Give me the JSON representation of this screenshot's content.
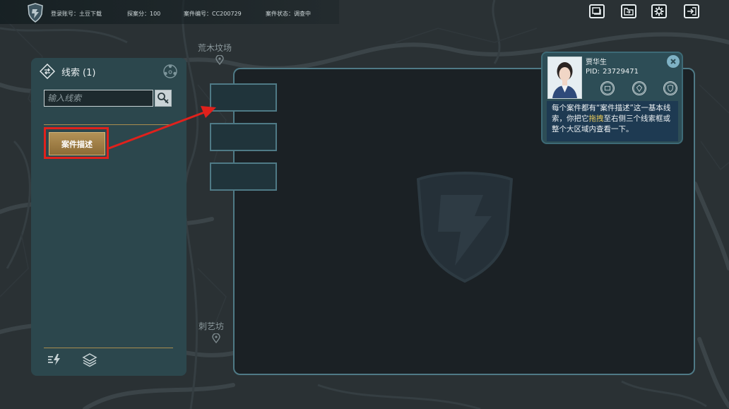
{
  "top_bar": {
    "account": "登录账号：土豆下载",
    "score": "探案分：100",
    "case_no": "案件编号：CC200729",
    "case_status": "案件状态：调查中",
    "buttons": [
      "screen-icon",
      "folder-icon",
      "gear-icon",
      "exit-icon"
    ]
  },
  "map": {
    "place_labels": [
      "荒木坟场",
      "刺艺坊"
    ]
  },
  "clue_panel": {
    "title": "线索",
    "count": "(1)",
    "search_placeholder": "输入线索",
    "clues": [
      "案件描述"
    ]
  },
  "npc": {
    "name": "贾华生",
    "pid_label": "PID:",
    "pid": "23729471",
    "dialog_before": "每个案件都有“案件描述”这一基本线索，你把它",
    "dialog_highlight": "拖拽",
    "dialog_after": "至右侧三个线索框或整个大区域内查看一下。"
  },
  "colors": {
    "panel": "#2c474d",
    "main_area": "#1b2125",
    "main_border": "#4f7a86",
    "clue_button": "#a5844a",
    "guide_red": "#e0211c",
    "highlight_text": "#e9cb5a",
    "dialog_bg": "#1e3a52"
  }
}
